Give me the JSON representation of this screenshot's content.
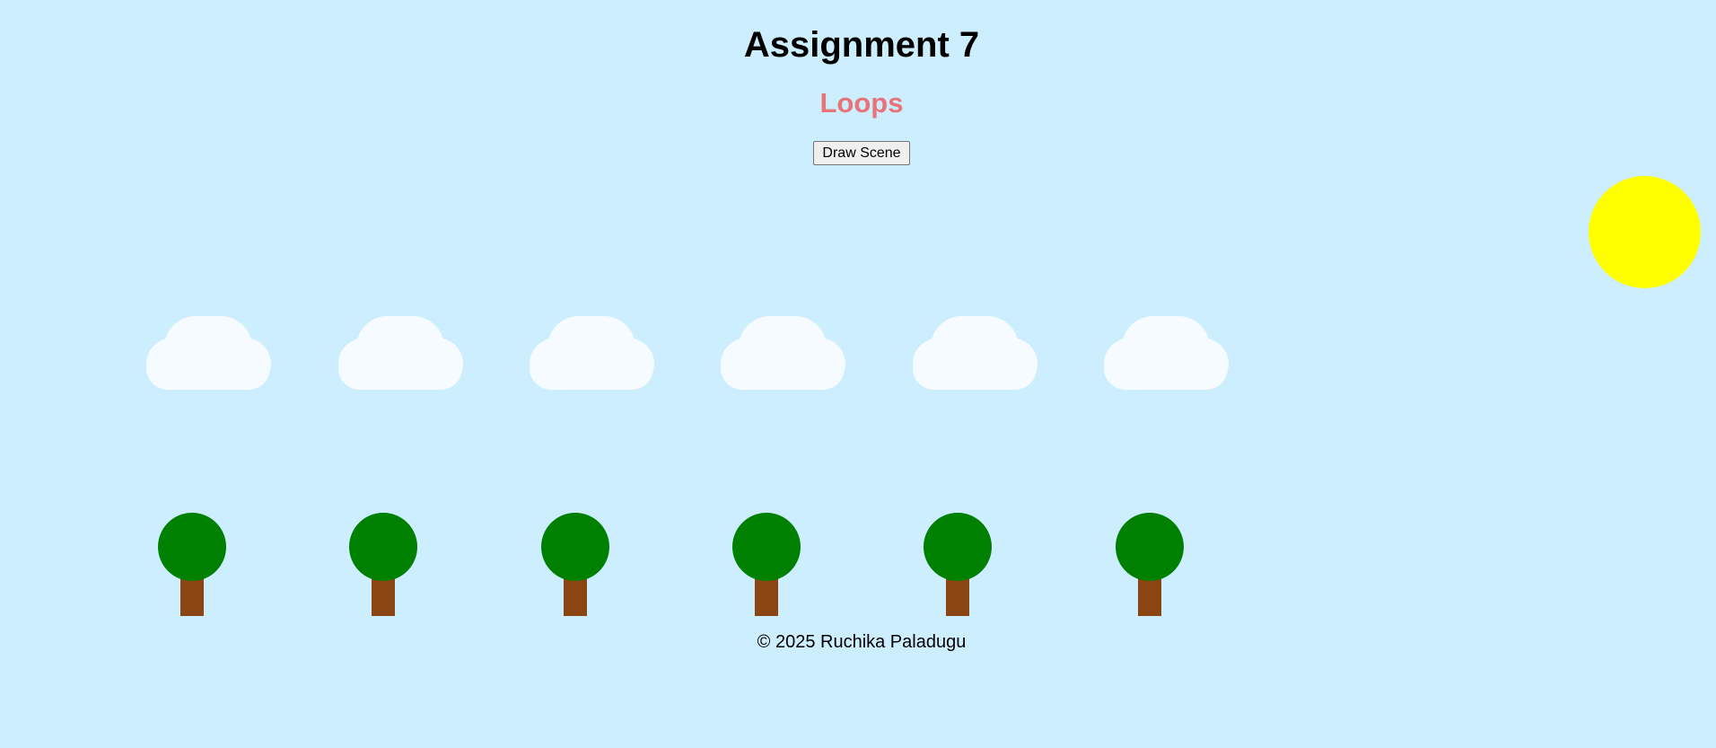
{
  "header": {
    "title": "Assignment 7",
    "subtitle": "Loops"
  },
  "controls": {
    "draw_button_label": "Draw Scene"
  },
  "scene": {
    "cloud_count": 6,
    "tree_count": 6,
    "colors": {
      "sky": "#cdeeff",
      "sun": "#ffff00",
      "cloud": "#f5fbff",
      "tree_crown": "#008000",
      "tree_trunk": "#8b4513",
      "subtitle": "#e8737a"
    }
  },
  "footer": {
    "text": "© 2025 Ruchika Paladugu"
  }
}
